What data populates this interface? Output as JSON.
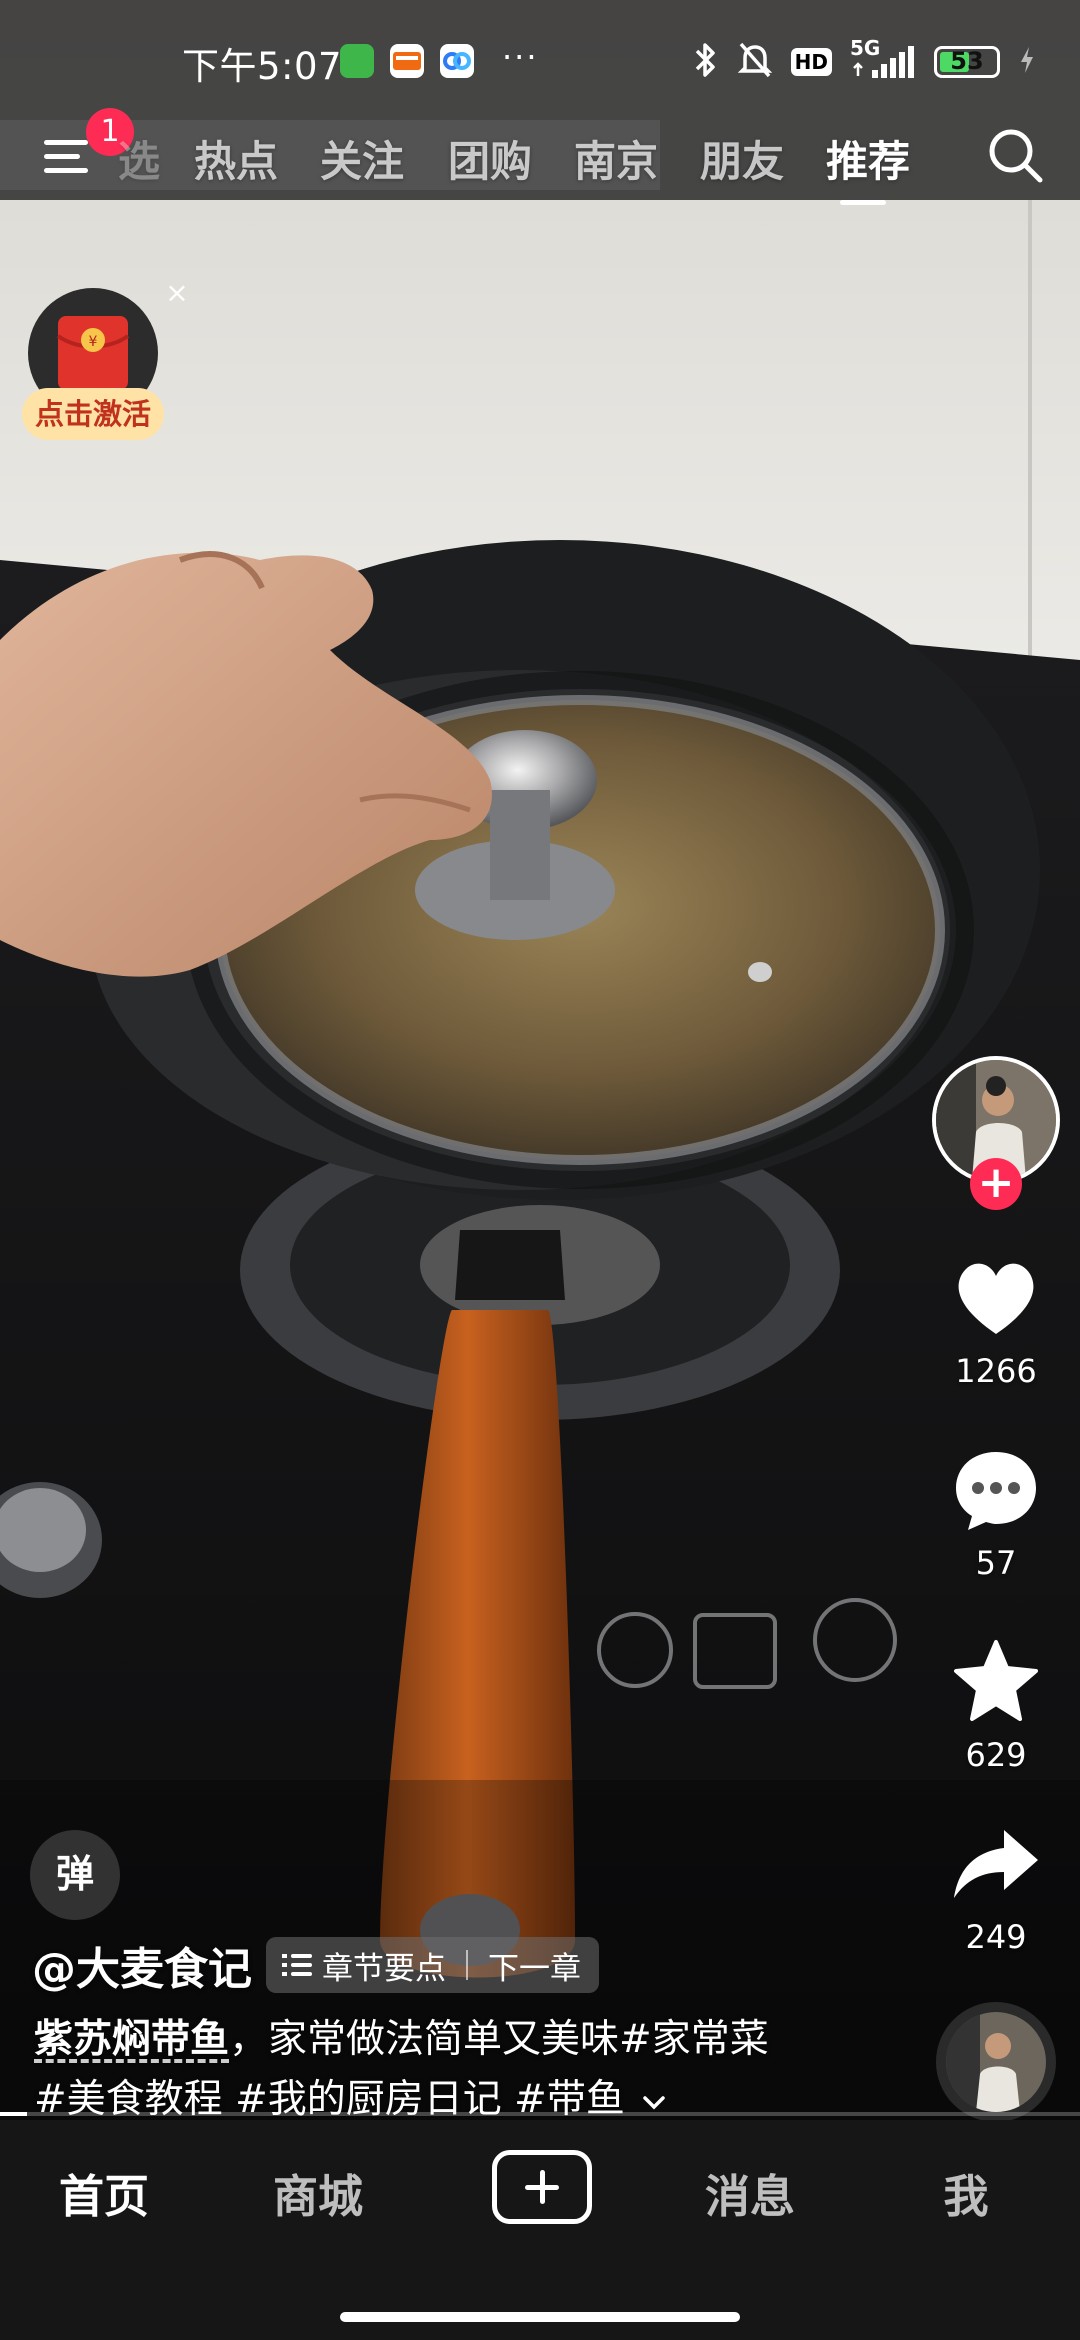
{
  "status_bar": {
    "time": "下午5:07",
    "network": "5G",
    "hd_label": "HD",
    "battery_level": "53",
    "battery_fraction": 0.53,
    "more_indicator": "···",
    "icons": [
      "app-notification-icon",
      "58-app-icon",
      "baidu-netdisk-icon",
      "bluetooth-icon",
      "mute-icon",
      "hd-icon",
      "signal-icon",
      "battery-icon",
      "charging-icon"
    ]
  },
  "top_nav": {
    "menu_badge": "1",
    "partial_tab": "选",
    "tabs": [
      "热点",
      "关注",
      "团购",
      "南京",
      "朋友",
      "推荐"
    ],
    "active_tab": "推荐"
  },
  "red_packet": {
    "label": "点击激活",
    "close": "×"
  },
  "actions": {
    "like_count": "1266",
    "comment_count": "57",
    "favorite_count": "629",
    "share_count": "249",
    "follow": "+"
  },
  "video_info": {
    "danmu_label": "弹",
    "author": "@大麦食记",
    "chapter_label": "章节要点",
    "next_chapter": "下一章",
    "title": "紫苏焖带鱼",
    "description_rest": "，家常做法简单又美味#家常菜",
    "hashtags_line": "#美食教程 #我的厨房日记 #带鱼",
    "progress_fraction": 0.025
  },
  "bottom_tabs": {
    "home": "首页",
    "mall": "商城",
    "messages": "消息",
    "me": "我",
    "active": "首页"
  },
  "colors": {
    "accent_red": "#fe2c55",
    "tab_bar_bg": "#161616",
    "battery_green": "#4cd964",
    "red_packet_label_bg": "#ffe3a6"
  }
}
